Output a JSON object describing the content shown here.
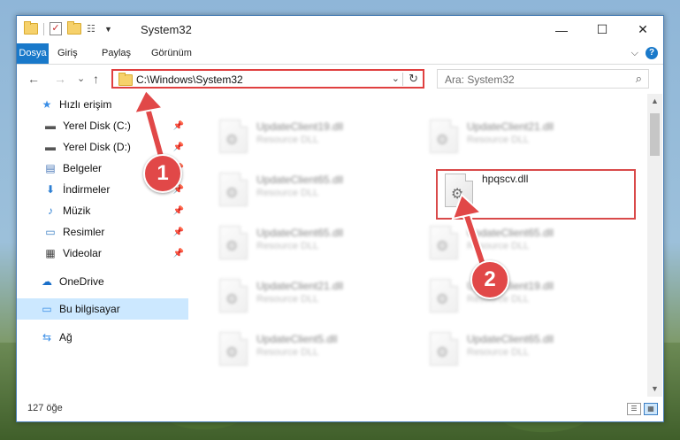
{
  "window": {
    "title": "System32",
    "minimize": "—",
    "maximize": "☐",
    "close": "✕"
  },
  "ribbon": {
    "tabs": [
      "Dosya",
      "Giriş",
      "Paylaş",
      "Görünüm"
    ],
    "expand": "⌵",
    "help": "?"
  },
  "nav": {
    "back": "←",
    "forward": "→",
    "recent": "⌄",
    "up": "↑",
    "address": "C:\\Windows\\System32",
    "address_drop": "⌄",
    "refresh": "↻",
    "search_placeholder": "Ara: System32",
    "search_icon": "⌕"
  },
  "sidebar": {
    "items": [
      {
        "label": "Hızlı erişim",
        "icon": "★",
        "icon_color": "#3a8ee6"
      },
      {
        "label": "Yerel Disk (C:)",
        "icon": "▬",
        "icon_color": "#555555",
        "pin": "📌"
      },
      {
        "label": "Yerel Disk (D:)",
        "icon": "▬",
        "icon_color": "#555555",
        "pin": "📌"
      },
      {
        "label": "Belgeler",
        "icon": "▤",
        "icon_color": "#4a78b8",
        "pin": "📌"
      },
      {
        "label": "İndirmeler",
        "icon": "⬇",
        "icon_color": "#2d7fd3",
        "pin": "📌"
      },
      {
        "label": "Müzik",
        "icon": "♪",
        "icon_color": "#2d7fd3",
        "pin": "📌"
      },
      {
        "label": "Resimler",
        "icon": "▭",
        "icon_color": "#3b7fc4",
        "pin": "📌"
      },
      {
        "label": "Videolar",
        "icon": "▦",
        "icon_color": "#444444",
        "pin": "📌"
      },
      {
        "label": "OneDrive",
        "icon": "☁",
        "icon_color": "#1a6fc9"
      },
      {
        "label": "Bu bilgisayar",
        "icon": "▭",
        "icon_color": "#3a8ee6",
        "selected": true
      },
      {
        "label": "Ağ",
        "icon": "⇆",
        "icon_color": "#3a8ee6"
      }
    ]
  },
  "files": [
    {
      "name": "UpdateClient19.dll",
      "desc": "Resource DLL"
    },
    {
      "name": "UpdateClient21.dll",
      "desc": "Resource DLL"
    },
    {
      "name": "UpdateClient65.dll",
      "desc": "Resource DLL"
    },
    {
      "name": "hpqscv.dll",
      "desc": ""
    },
    {
      "name": "UpdateClient65.dll",
      "desc": "Resource DLL"
    },
    {
      "name": "UpdateClient65.dll",
      "desc": "Resource DLL"
    },
    {
      "name": "UpdateClient21.dll",
      "desc": "Resource DLL"
    },
    {
      "name": "UpdateClient19.dll",
      "desc": "Resource DLL"
    },
    {
      "name": "UpdateClient5.dll",
      "desc": "Resource DLL"
    },
    {
      "name": "UpdateClient65.dll",
      "desc": "Resource DLL"
    }
  ],
  "status": {
    "count": "127 öğe"
  },
  "annotations": {
    "step1": "1",
    "step2": "2",
    "color": "#e14848"
  }
}
